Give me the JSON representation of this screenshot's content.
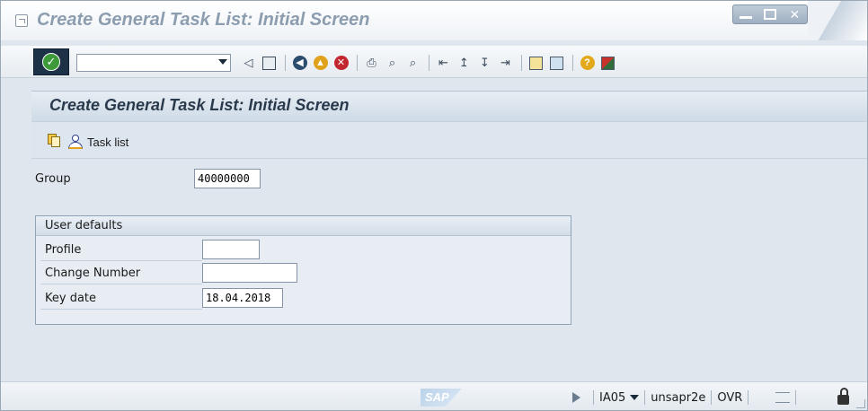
{
  "window": {
    "title": "Create General Task List: Initial Screen"
  },
  "toolbar": {
    "command_field_value": "",
    "icons": [
      "enter-icon",
      "back-icon",
      "save-icon",
      "exit-icon",
      "cancel-icon",
      "print-icon",
      "find-icon",
      "find-next-icon",
      "first-page-icon",
      "previous-page-icon",
      "next-page-icon",
      "last-page-icon",
      "create-session-icon",
      "shortcut-icon",
      "help-icon",
      "layout-menu-icon"
    ]
  },
  "screen": {
    "title": "Create General Task List: Initial Screen",
    "app_toolbar": {
      "task_list_label": "Task list"
    },
    "group": {
      "label": "Group",
      "value": "40000000"
    },
    "user_defaults": {
      "heading": "User defaults",
      "profile": {
        "label": "Profile",
        "value": ""
      },
      "change_number": {
        "label": "Change Number",
        "value": ""
      },
      "key_date": {
        "label": "Key date",
        "value": "18.04.2018"
      }
    }
  },
  "statusbar": {
    "logo_text": "SAP",
    "transaction": "IA05",
    "server": "unsapr2e",
    "mode": "OVR"
  },
  "colors": {
    "ok_button_bg": "#1e3247",
    "ok_check": "#3c9a39",
    "title_text": "#8c9db0",
    "screen_title": "#2a3a4d",
    "content_bg": "#dfe6ed"
  }
}
